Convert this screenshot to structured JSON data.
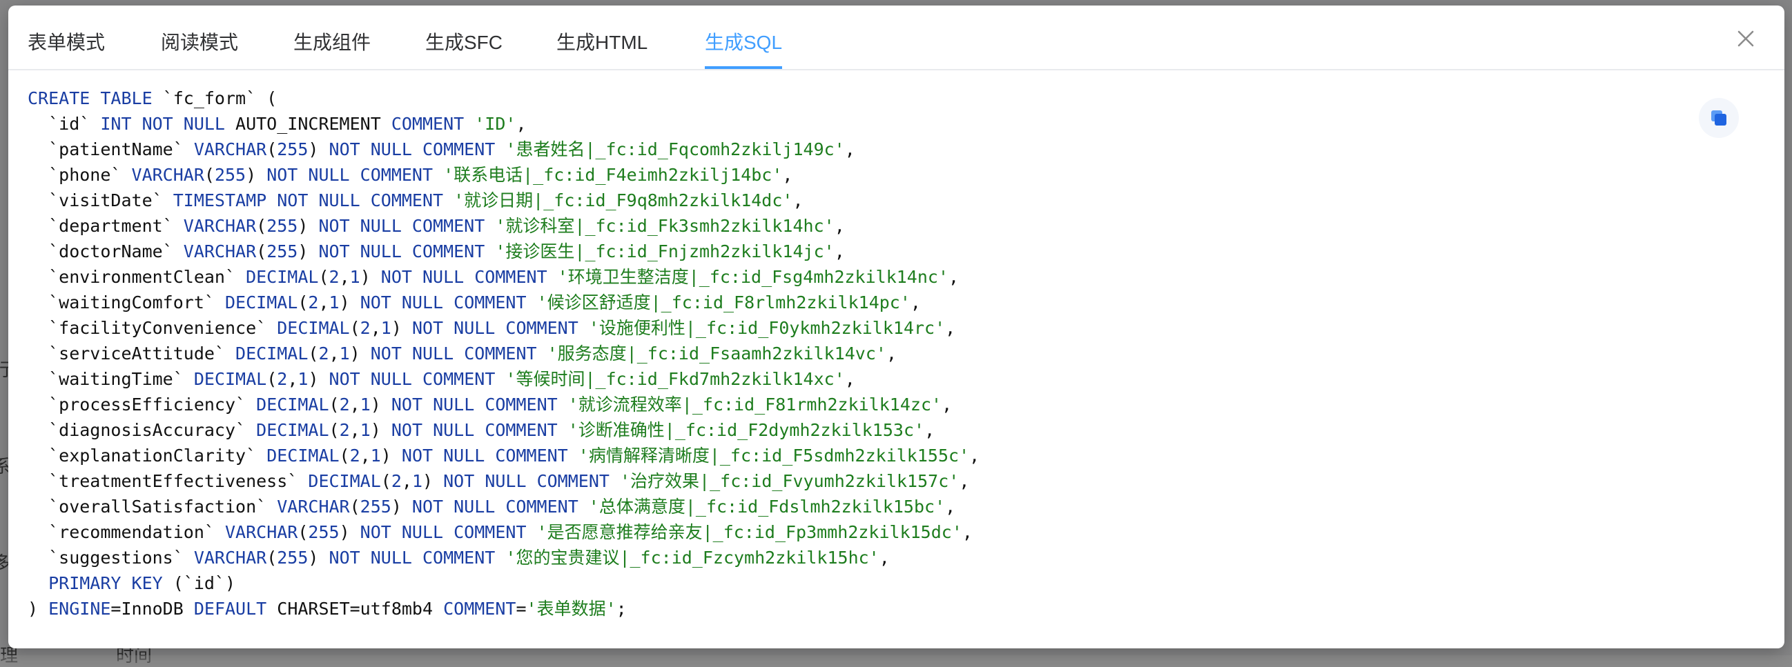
{
  "tabs": [
    {
      "label": "表单模式",
      "active": false
    },
    {
      "label": "阅读模式",
      "active": false
    },
    {
      "label": "生成组件",
      "active": false
    },
    {
      "label": "生成SFC",
      "active": false
    },
    {
      "label": "生成HTML",
      "active": false
    },
    {
      "label": "生成SQL",
      "active": true
    }
  ],
  "icons": {
    "close": "close-icon",
    "copy": "copy-icon"
  },
  "colors": {
    "accent": "#409eff",
    "keyword": "#1a3ea3",
    "string": "#1e7d1e"
  },
  "background_fragments": [
    "行",
    "系",
    "多",
    "理",
    "时间"
  ],
  "sql": {
    "header": [
      {
        "t": "kw",
        "v": "CREATE TABLE "
      },
      {
        "t": "plain",
        "v": "`fc_form` ("
      }
    ],
    "id_line": [
      {
        "t": "plain",
        "v": "  `id` "
      },
      {
        "t": "kw",
        "v": "INT NOT NULL "
      },
      {
        "t": "plain",
        "v": "AUTO_INCREMENT "
      },
      {
        "t": "kw",
        "v": "COMMENT "
      },
      {
        "t": "str",
        "v": "'ID'"
      },
      {
        "t": "plain",
        "v": ","
      }
    ],
    "columns": [
      {
        "name": "`patientName`",
        "type": "VARCHAR",
        "args": "255",
        "comment": "'患者姓名|_fc:id_Fqcomh2zkilj149c'"
      },
      {
        "name": "`phone`",
        "type": "VARCHAR",
        "args": "255",
        "comment": "'联系电话|_fc:id_F4eimh2zkilj14bc'"
      },
      {
        "name": "`visitDate`",
        "type": "TIMESTAMP",
        "args": "",
        "comment": "'就诊日期|_fc:id_F9q8mh2zkilk14dc'"
      },
      {
        "name": "`department`",
        "type": "VARCHAR",
        "args": "255",
        "comment": "'就诊科室|_fc:id_Fk3smh2zkilk14hc'"
      },
      {
        "name": "`doctorName`",
        "type": "VARCHAR",
        "args": "255",
        "comment": "'接诊医生|_fc:id_Fnjzmh2zkilk14jc'"
      },
      {
        "name": "`environmentClean`",
        "type": "DECIMAL",
        "args": "2,1",
        "comment": "'环境卫生整洁度|_fc:id_Fsg4mh2zkilk14nc'"
      },
      {
        "name": "`waitingComfort`",
        "type": "DECIMAL",
        "args": "2,1",
        "comment": "'候诊区舒适度|_fc:id_F8rlmh2zkilk14pc'"
      },
      {
        "name": "`facilityConvenience`",
        "type": "DECIMAL",
        "args": "2,1",
        "comment": "'设施便利性|_fc:id_F0ykmh2zkilk14rc'"
      },
      {
        "name": "`serviceAttitude`",
        "type": "DECIMAL",
        "args": "2,1",
        "comment": "'服务态度|_fc:id_Fsaamh2zkilk14vc'"
      },
      {
        "name": "`waitingTime`",
        "type": "DECIMAL",
        "args": "2,1",
        "comment": "'等候时间|_fc:id_Fkd7mh2zkilk14xc'"
      },
      {
        "name": "`processEfficiency`",
        "type": "DECIMAL",
        "args": "2,1",
        "comment": "'就诊流程效率|_fc:id_F81rmh2zkilk14zc'"
      },
      {
        "name": "`diagnosisAccuracy`",
        "type": "DECIMAL",
        "args": "2,1",
        "comment": "'诊断准确性|_fc:id_F2dymh2zkilk153c'"
      },
      {
        "name": "`explanationClarity`",
        "type": "DECIMAL",
        "args": "2,1",
        "comment": "'病情解释清晰度|_fc:id_F5sdmh2zkilk155c'"
      },
      {
        "name": "`treatmentEffectiveness`",
        "type": "DECIMAL",
        "args": "2,1",
        "comment": "'治疗效果|_fc:id_Fvyumh2zkilk157c'"
      },
      {
        "name": "`overallSatisfaction`",
        "type": "VARCHAR",
        "args": "255",
        "comment": "'总体满意度|_fc:id_Fdslmh2zkilk15bc'"
      },
      {
        "name": "`recommendation`",
        "type": "VARCHAR",
        "args": "255",
        "comment": "'是否愿意推荐给亲友|_fc:id_Fp3mmh2zkilk15dc'"
      },
      {
        "name": "`suggestions`",
        "type": "VARCHAR",
        "args": "255",
        "comment": "'您的宝贵建议|_fc:id_Fzcymh2zkilk15hc'"
      }
    ],
    "primary_key_line": [
      {
        "t": "kw",
        "v": "  PRIMARY KEY "
      },
      {
        "t": "plain",
        "v": "(`id`)"
      }
    ],
    "footer": [
      {
        "t": "plain",
        "v": ") "
      },
      {
        "t": "kw",
        "v": "ENGINE"
      },
      {
        "t": "plain",
        "v": "=InnoDB "
      },
      {
        "t": "kw",
        "v": "DEFAULT "
      },
      {
        "t": "plain",
        "v": "CHARSET=utf8mb4 "
      },
      {
        "t": "kw",
        "v": "COMMENT"
      },
      {
        "t": "plain",
        "v": "="
      },
      {
        "t": "str",
        "v": "'表单数据'"
      },
      {
        "t": "plain",
        "v": ";"
      }
    ]
  }
}
